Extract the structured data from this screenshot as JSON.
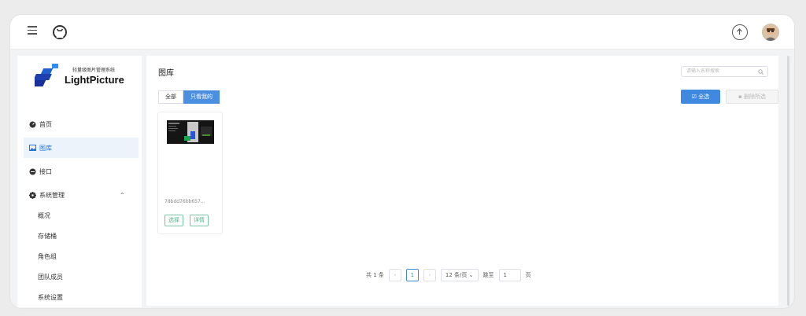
{
  "sidebar": {
    "logo_small": "轻量级图片管理系统",
    "logo_big": "LightPicture",
    "items": [
      {
        "label": "首页"
      },
      {
        "label": "图库"
      },
      {
        "label": "接口"
      },
      {
        "label": "系统管理"
      }
    ],
    "sub_items": [
      "概况",
      "存储桶",
      "角色组",
      "团队成员",
      "系统设置"
    ]
  },
  "main": {
    "title": "图库",
    "search_placeholder": "请输入名称搜索",
    "tabs": [
      "全部",
      "只看我的"
    ],
    "select_all": "全选",
    "delete_selected": "删除所选",
    "card": {
      "name": "78bdd76bb657…",
      "select_label": "选择",
      "detail_label": "详情"
    },
    "pagination": {
      "total": "共 1 条",
      "current_page": "1",
      "page_size": "12 条/页",
      "jump_label": "跳至",
      "jump_value": "1",
      "page_unit": "页"
    }
  },
  "colors": {
    "accent": "#3f89e0",
    "active_bg": "#ecf3fb",
    "success": "#56b08b"
  },
  "icons": [
    "menu-icon",
    "github-icon",
    "upload-icon",
    "avatar",
    "dashboard-icon",
    "image-icon",
    "api-icon",
    "settings-icon",
    "chevron-up-icon",
    "search-icon",
    "check-icon",
    "trash-icon",
    "chevron-left-icon",
    "chevron-right-icon",
    "chevron-down-icon"
  ]
}
